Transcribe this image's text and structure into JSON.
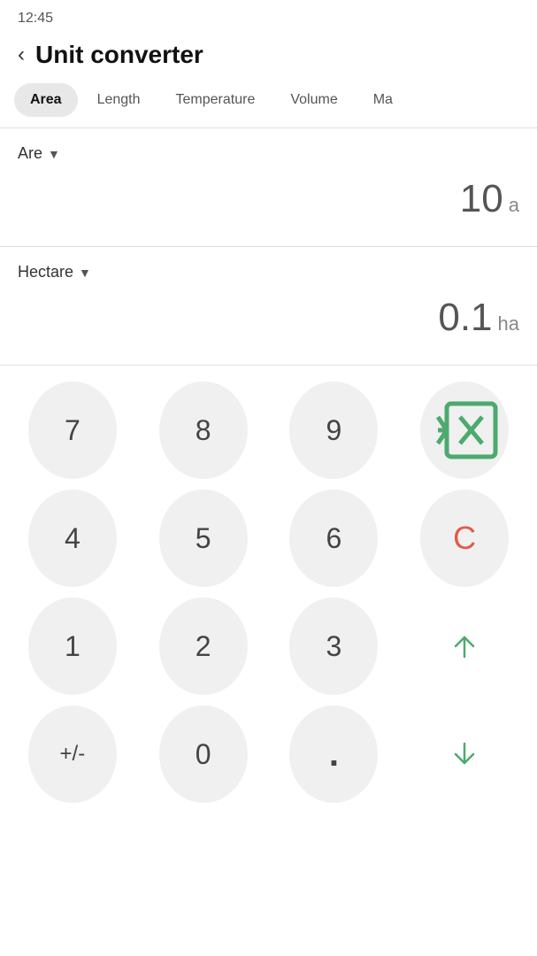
{
  "status": {
    "time": "12:45"
  },
  "header": {
    "back_label": "<",
    "title": "Unit converter"
  },
  "tabs": [
    {
      "id": "area",
      "label": "Area",
      "active": true
    },
    {
      "id": "length",
      "label": "Length",
      "active": false
    },
    {
      "id": "temperature",
      "label": "Temperature",
      "active": false
    },
    {
      "id": "volume",
      "label": "Volume",
      "active": false
    },
    {
      "id": "mass",
      "label": "Ma",
      "active": false
    }
  ],
  "unit_from": {
    "name": "Are",
    "value": "10",
    "unit_symbol": "a"
  },
  "unit_to": {
    "name": "Hectare",
    "value": "0.1",
    "unit_symbol": "ha"
  },
  "keypad": {
    "rows": [
      [
        "7",
        "8",
        "9",
        "⌫"
      ],
      [
        "4",
        "5",
        "6",
        "C"
      ],
      [
        "1",
        "2",
        "3",
        "↑"
      ],
      [
        "+/-",
        "0",
        ".",
        "↓"
      ]
    ]
  },
  "colors": {
    "accent_green": "#4caa6e",
    "accent_red": "#e05c4a",
    "tab_active_bg": "#e8e8e8"
  }
}
